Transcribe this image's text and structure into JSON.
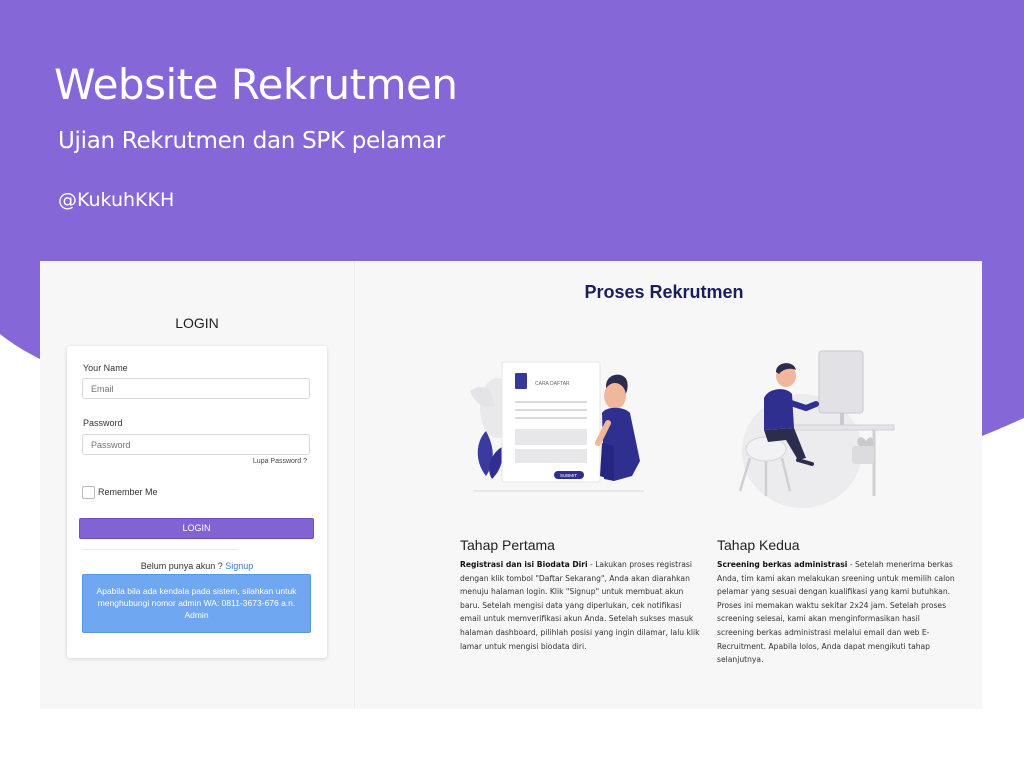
{
  "banner": {
    "title": "Website Rekrutmen",
    "subtitle": "Ujian Rekrutmen dan SPK pelamar",
    "handle": "@KukuhKKH",
    "colors": {
      "banner": "#8667d7",
      "accent": "#8163d3",
      "heading": "#1a1f5c"
    }
  },
  "login": {
    "title": "LOGIN",
    "name_label": "Your Name",
    "email_placeholder": "Email",
    "password_label": "Password",
    "password_placeholder": "Password",
    "forgot": "Lupa Password ?",
    "remember": "Remember Me",
    "button": "LOGIN",
    "signup_prompt": "Belum punya akun ?",
    "signup_link": "Signup",
    "alert": "Apabila bila ada kendala pada sistem, silahkan untuk menghubungi nomor admin WA: 0811-3673-676 a.n. Admin"
  },
  "process": {
    "title": "Proses Rekrutmen",
    "illustration1": {
      "form_title": "CARA DAFTAR",
      "submit": "SUBMIT"
    },
    "step1": {
      "title": "Tahap Pertama",
      "bold": "Registrasi dan isi Biodata Diri",
      "text": " - Lakukan proses registrasi dengan klik tombol \"Daftar Sekarang\", Anda akan diarahkan menuju halaman login. Klik \"Signup\" untuk membuat akun baru. Setelah mengisi data yang diperlukan, cek notifikasi email untuk memverifikasi akun Anda. Setelah sukses masuk halaman dashboard, pilihlah posisi yang ingin dilamar, lalu klik lamar untuk mengisi biodata diri."
    },
    "step2": {
      "title": "Tahap Kedua",
      "bold": "Screening berkas administrasi",
      "text": " - Setelah menerima berkas Anda, tim kami akan melakukan sreening untuk memilih calon pelamar yang sesuai dengan kualifikasi yang kami butuhkan. Proses ini memakan waktu sekitar 2x24 jam. Setelah proses screening selesai, kami akan menginformasikan hasil screening berkas administrasi melalui email dan web E-Recruitment. Apabila lolos, Anda dapat mengikuti tahap selanjutnya."
    }
  }
}
